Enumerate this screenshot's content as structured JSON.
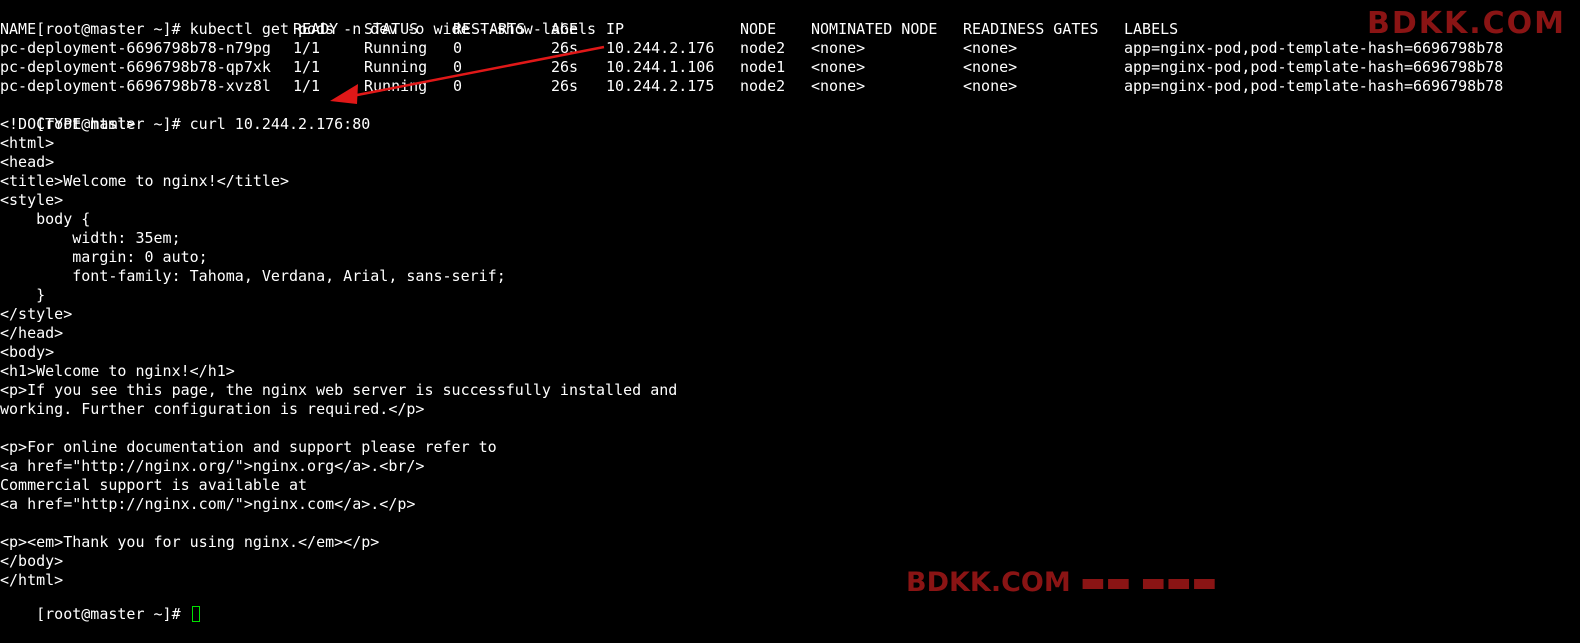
{
  "terminal": {
    "prompt_1": "[root@master ~]# ",
    "command_1": "kubectl get pods -n dev -o wide --show-labels",
    "table": {
      "headers": [
        "NAME",
        "READY",
        "STATUS",
        "RESTARTS",
        "AGE",
        "IP",
        "NODE",
        "NOMINATED NODE",
        "READINESS GATES",
        "LABELS"
      ],
      "rows": [
        [
          "pc-deployment-6696798b78-n79pg",
          "1/1",
          "Running",
          "0",
          "26s",
          "10.244.2.176",
          "node2",
          "<none>",
          "<none>",
          "app=nginx-pod,pod-template-hash=6696798b78"
        ],
        [
          "pc-deployment-6696798b78-qp7xk",
          "1/1",
          "Running",
          "0",
          "26s",
          "10.244.1.106",
          "node1",
          "<none>",
          "<none>",
          "app=nginx-pod,pod-template-hash=6696798b78"
        ],
        [
          "pc-deployment-6696798b78-xvz8l",
          "1/1",
          "Running",
          "0",
          "26s",
          "10.244.2.175",
          "node2",
          "<none>",
          "<none>",
          "app=nginx-pod,pod-template-hash=6696798b78"
        ]
      ]
    },
    "prompt_2": "[root@master ~]# ",
    "command_2": "curl 10.244.2.176:80",
    "output": [
      "<!DOCTYPE html>",
      "<html>",
      "<head>",
      "<title>Welcome to nginx!</title>",
      "<style>",
      "    body {",
      "        width: 35em;",
      "        margin: 0 auto;",
      "        font-family: Tahoma, Verdana, Arial, sans-serif;",
      "    }",
      "</style>",
      "</head>",
      "<body>",
      "<h1>Welcome to nginx!</h1>",
      "<p>If you see this page, the nginx web server is successfully installed and",
      "working. Further configuration is required.</p>",
      "",
      "<p>For online documentation and support please refer to",
      "<a href=\"http://nginx.org/\">nginx.org</a>.<br/>",
      "Commercial support is available at",
      "<a href=\"http://nginx.com/\">nginx.com</a>.</p>",
      "",
      "<p><em>Thank you for using nginx.</em></p>",
      "</body>",
      "</html>"
    ],
    "prompt_3": "[root@master ~]# "
  },
  "watermark": {
    "top": "BDKK.COM",
    "bottom": "BDKK.COM ▬▬ ▬▬▬"
  },
  "colors": {
    "background": "#000000",
    "text": "#ffffff",
    "cursor": "#00e000",
    "annotation_arrow": "#e01818",
    "watermark": "#8a1414"
  }
}
